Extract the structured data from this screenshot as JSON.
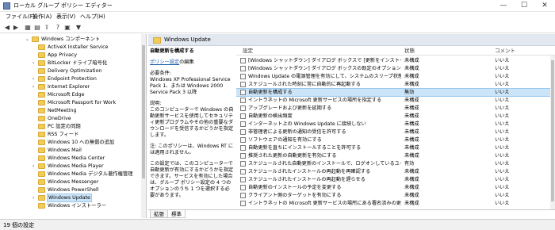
{
  "window": {
    "title": "ローカル グループ ポリシー エディター",
    "minimize": "—",
    "maximize": "☐",
    "close": "✕"
  },
  "menu": [
    "ファイル(F)",
    "操作(A)",
    "表示(V)",
    "ヘルプ(H)"
  ],
  "toolbar": [
    "◀",
    "▶",
    "▦",
    "▤",
    "⇪",
    "?",
    "▣",
    "▼"
  ],
  "tree": [
    {
      "label": "Windows コンポーネント",
      "expander": "⌄"
    },
    {
      "label": "ActiveX Installer Service"
    },
    {
      "label": "App Privacy"
    },
    {
      "label": "BitLocker ドライブ暗号化",
      "expander": "›"
    },
    {
      "label": "Delivery Optimization"
    },
    {
      "label": "Endpoint Protection",
      "expander": "›"
    },
    {
      "label": "Internet Explorer",
      "expander": "›"
    },
    {
      "label": "Microsoft Edge"
    },
    {
      "label": "Microsoft Passport for Work"
    },
    {
      "label": "NetMeeting"
    },
    {
      "label": "OneDrive"
    },
    {
      "label": "PC 設定の同期"
    },
    {
      "label": "RSS フィード"
    },
    {
      "label": "Windows 10 への無償の追加"
    },
    {
      "label": "Windows Mail"
    },
    {
      "label": "Windows Media Center"
    },
    {
      "label": "Windows Media Player",
      "expander": "›"
    },
    {
      "label": "Windows Media デジタル著作権管理"
    },
    {
      "label": "Windows Messenger"
    },
    {
      "label": "Windows PowerShell"
    },
    {
      "label": "Windows Update",
      "expander": "›",
      "selected": true
    },
    {
      "label": "Windows インストーラー"
    }
  ],
  "details": {
    "header": "Windows Update",
    "policy_title": "自動更新を構成する",
    "edit_link": "ポリシー設定",
    "edit_suffix": "の編集",
    "req_label": "必要条件:",
    "requirements": "Windows XP Professional Service Pack 1、または Windows 2000 Service Pack 3 以降",
    "desc_label": "説明:",
    "description": "このコンピューターで Windows の自動更新サービスを使用してセキュリティ更新プログラムやその他の重要なダウンロードを受信するかどうかを指定します。",
    "note": "注: このポリシーは、Windows RT には適用されません。",
    "extra": "この設定では、このコンピューターで自動更新が有効にするかどうかを指定できます。サービスを有効にした場合は、グループ ポリシー設定の 4 つのオプションのうち 1 つを選択する必要があります。"
  },
  "list": {
    "columns": {
      "setting": "設定",
      "state": "状態",
      "comment": "コメント"
    },
    "rows": [
      {
        "setting": "[Windows シャットダウン] ダイアログ ボックスで [更新をインストールしてシャットダウン] オプションを表示しない",
        "state": "未構成",
        "comment": "いいえ"
      },
      {
        "setting": "[Windows シャットダウン] ダイアログ ボックスの既定のオプションを [更新をインストールしてシャットダウン] に調整しない",
        "state": "未構成",
        "comment": "いいえ"
      },
      {
        "setting": "Windows Update の電源管理を有効にして、システムのスリープ状態を自動的に解除し",
        "state": "未構成",
        "comment": "いいえ"
      },
      {
        "setting": "スケジュールされた時刻に常に自動的に再起動する",
        "state": "未構成",
        "comment": "いいえ"
      },
      {
        "setting": "自動更新を構成する",
        "state": "無効",
        "comment": "いいえ",
        "selected": true
      },
      {
        "setting": "イントラネットの Microsoft 更新サービスの場所を指定する",
        "state": "未構成",
        "comment": "いいえ"
      },
      {
        "setting": "アップグレードおよび更新を延期する",
        "state": "未構成",
        "comment": "いいえ"
      },
      {
        "setting": "自動更新の検出頻度",
        "state": "未構成",
        "comment": "いいえ"
      },
      {
        "setting": "インターネット上の Windows Update に接続しない",
        "state": "未構成",
        "comment": "いいえ"
      },
      {
        "setting": "非管理者による更新の通知の受信を許可する",
        "state": "未構成",
        "comment": "いいえ"
      },
      {
        "setting": "ソフトウェアの通知を有効にする",
        "state": "未構成",
        "comment": "いいえ"
      },
      {
        "setting": "自動更新を直ちにインストールすることを許可する",
        "state": "未構成",
        "comment": "いいえ"
      },
      {
        "setting": "推奨された更新の自動更新を有効にする",
        "state": "未構成",
        "comment": "いいえ"
      },
      {
        "setting": "スケジュールされた自動更新のインストールで、ログオンしているユーザーがいる場合には自動的に再起動しない",
        "state": "有効",
        "comment": "いいえ"
      },
      {
        "setting": "スケジュールされたインストールの再起動を再確認する",
        "state": "未構成",
        "comment": "いいえ"
      },
      {
        "setting": "スケジュールされたインストールの再起動を遅らせる",
        "state": "未構成",
        "comment": "いいえ"
      },
      {
        "setting": "自動更新のインストールの予定を変更する",
        "state": "未構成",
        "comment": "いいえ"
      },
      {
        "setting": "クライアント側のターゲットを有効にする",
        "state": "未構成",
        "comment": "いいえ"
      },
      {
        "setting": "イントラネットの Microsoft 更新サービスの場所にある署名済みの更新を許可する",
        "state": "未構成",
        "comment": "いいえ"
      }
    ]
  },
  "tabs": [
    "拡張",
    "標準"
  ],
  "status": "19 個の設定"
}
